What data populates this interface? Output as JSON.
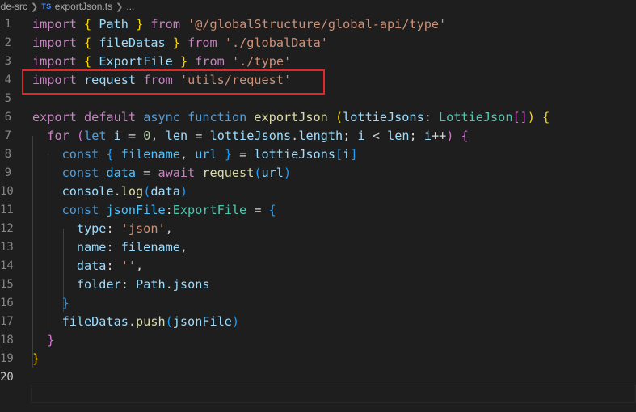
{
  "breadcrumb": {
    "folder": "ode-src",
    "file_icon": "TS",
    "file": "exportJson.ts",
    "trail": "..."
  },
  "editor": {
    "language": "typescript",
    "current_line": 20,
    "highlighted_line": 4,
    "highlight_color": "#e0282c",
    "lines": [
      {
        "num": "1",
        "tokens": [
          {
            "t": "import",
            "c": "keyword"
          },
          {
            "t": " ",
            "c": "punct"
          },
          {
            "t": "{",
            "c": "b1"
          },
          {
            "t": " ",
            "c": "punct"
          },
          {
            "t": "Path",
            "c": "var"
          },
          {
            "t": " ",
            "c": "punct"
          },
          {
            "t": "}",
            "c": "b1"
          },
          {
            "t": " ",
            "c": "punct"
          },
          {
            "t": "from",
            "c": "keyword"
          },
          {
            "t": " ",
            "c": "punct"
          },
          {
            "t": "'@/globalStructure/global-api/type'",
            "c": "string"
          }
        ]
      },
      {
        "num": "2",
        "tokens": [
          {
            "t": "import",
            "c": "keyword"
          },
          {
            "t": " ",
            "c": "punct"
          },
          {
            "t": "{",
            "c": "b1"
          },
          {
            "t": " ",
            "c": "punct"
          },
          {
            "t": "fileDatas",
            "c": "var"
          },
          {
            "t": " ",
            "c": "punct"
          },
          {
            "t": "}",
            "c": "b1"
          },
          {
            "t": " ",
            "c": "punct"
          },
          {
            "t": "from",
            "c": "keyword"
          },
          {
            "t": " ",
            "c": "punct"
          },
          {
            "t": "'./globalData'",
            "c": "string"
          }
        ]
      },
      {
        "num": "3",
        "tokens": [
          {
            "t": "import",
            "c": "keyword"
          },
          {
            "t": " ",
            "c": "punct"
          },
          {
            "t": "{",
            "c": "b1"
          },
          {
            "t": " ",
            "c": "punct"
          },
          {
            "t": "ExportFile",
            "c": "var"
          },
          {
            "t": " ",
            "c": "punct"
          },
          {
            "t": "}",
            "c": "b1"
          },
          {
            "t": " ",
            "c": "punct"
          },
          {
            "t": "from",
            "c": "keyword"
          },
          {
            "t": " ",
            "c": "punct"
          },
          {
            "t": "'./type'",
            "c": "string"
          }
        ]
      },
      {
        "num": "4",
        "tokens": [
          {
            "t": "import",
            "c": "keyword"
          },
          {
            "t": " ",
            "c": "punct"
          },
          {
            "t": "request",
            "c": "var"
          },
          {
            "t": " ",
            "c": "punct"
          },
          {
            "t": "from",
            "c": "keyword"
          },
          {
            "t": " ",
            "c": "punct"
          },
          {
            "t": "'utils/request'",
            "c": "string"
          }
        ]
      },
      {
        "num": "5",
        "tokens": []
      },
      {
        "num": "6",
        "tokens": [
          {
            "t": "export",
            "c": "keyword"
          },
          {
            "t": " ",
            "c": "punct"
          },
          {
            "t": "default",
            "c": "keyword"
          },
          {
            "t": " ",
            "c": "punct"
          },
          {
            "t": "async",
            "c": "storage"
          },
          {
            "t": " ",
            "c": "punct"
          },
          {
            "t": "function",
            "c": "storage"
          },
          {
            "t": " ",
            "c": "punct"
          },
          {
            "t": "exportJson",
            "c": "func"
          },
          {
            "t": " ",
            "c": "punct"
          },
          {
            "t": "(",
            "c": "b1"
          },
          {
            "t": "lottieJsons",
            "c": "var"
          },
          {
            "t": ": ",
            "c": "punct"
          },
          {
            "t": "LottieJson",
            "c": "type"
          },
          {
            "t": "[]",
            "c": "b2"
          },
          {
            "t": ")",
            "c": "b1"
          },
          {
            "t": " ",
            "c": "punct"
          },
          {
            "t": "{",
            "c": "b1"
          }
        ]
      },
      {
        "num": "7",
        "tokens": [
          {
            "t": "  ",
            "c": "punct"
          },
          {
            "t": "for",
            "c": "keyword"
          },
          {
            "t": " ",
            "c": "punct"
          },
          {
            "t": "(",
            "c": "b2"
          },
          {
            "t": "let",
            "c": "storage"
          },
          {
            "t": " ",
            "c": "punct"
          },
          {
            "t": "i",
            "c": "var"
          },
          {
            "t": " = ",
            "c": "punct"
          },
          {
            "t": "0",
            "c": "number"
          },
          {
            "t": ", ",
            "c": "punct"
          },
          {
            "t": "len",
            "c": "var"
          },
          {
            "t": " = ",
            "c": "punct"
          },
          {
            "t": "lottieJsons",
            "c": "var"
          },
          {
            "t": ".",
            "c": "punct"
          },
          {
            "t": "length",
            "c": "var"
          },
          {
            "t": "; ",
            "c": "punct"
          },
          {
            "t": "i",
            "c": "var"
          },
          {
            "t": " < ",
            "c": "punct"
          },
          {
            "t": "len",
            "c": "var"
          },
          {
            "t": "; ",
            "c": "punct"
          },
          {
            "t": "i",
            "c": "var"
          },
          {
            "t": "++",
            "c": "punct"
          },
          {
            "t": ")",
            "c": "b2"
          },
          {
            "t": " ",
            "c": "punct"
          },
          {
            "t": "{",
            "c": "b2"
          }
        ]
      },
      {
        "num": "8",
        "tokens": [
          {
            "t": "    ",
            "c": "punct"
          },
          {
            "t": "const",
            "c": "storage"
          },
          {
            "t": " ",
            "c": "punct"
          },
          {
            "t": "{",
            "c": "b3"
          },
          {
            "t": " ",
            "c": "punct"
          },
          {
            "t": "filename",
            "c": "const"
          },
          {
            "t": ", ",
            "c": "punct"
          },
          {
            "t": "url",
            "c": "const"
          },
          {
            "t": " ",
            "c": "punct"
          },
          {
            "t": "}",
            "c": "b3"
          },
          {
            "t": " = ",
            "c": "punct"
          },
          {
            "t": "lottieJsons",
            "c": "var"
          },
          {
            "t": "[",
            "c": "b3"
          },
          {
            "t": "i",
            "c": "var"
          },
          {
            "t": "]",
            "c": "b3"
          }
        ]
      },
      {
        "num": "9",
        "tokens": [
          {
            "t": "    ",
            "c": "punct"
          },
          {
            "t": "const",
            "c": "storage"
          },
          {
            "t": " ",
            "c": "punct"
          },
          {
            "t": "data",
            "c": "const"
          },
          {
            "t": " = ",
            "c": "punct"
          },
          {
            "t": "await",
            "c": "keyword"
          },
          {
            "t": " ",
            "c": "punct"
          },
          {
            "t": "request",
            "c": "func"
          },
          {
            "t": "(",
            "c": "b3"
          },
          {
            "t": "url",
            "c": "var"
          },
          {
            "t": ")",
            "c": "b3"
          }
        ]
      },
      {
        "num": "10",
        "tokens": [
          {
            "t": "    ",
            "c": "punct"
          },
          {
            "t": "console",
            "c": "var"
          },
          {
            "t": ".",
            "c": "punct"
          },
          {
            "t": "log",
            "c": "func"
          },
          {
            "t": "(",
            "c": "b3"
          },
          {
            "t": "data",
            "c": "var"
          },
          {
            "t": ")",
            "c": "b3"
          }
        ]
      },
      {
        "num": "11",
        "tokens": [
          {
            "t": "    ",
            "c": "punct"
          },
          {
            "t": "const",
            "c": "storage"
          },
          {
            "t": " ",
            "c": "punct"
          },
          {
            "t": "jsonFile",
            "c": "const"
          },
          {
            "t": ":",
            "c": "punct"
          },
          {
            "t": "ExportFile",
            "c": "type"
          },
          {
            "t": " = ",
            "c": "punct"
          },
          {
            "t": "{",
            "c": "b3"
          }
        ]
      },
      {
        "num": "12",
        "tokens": [
          {
            "t": "      ",
            "c": "punct"
          },
          {
            "t": "type",
            "c": "var"
          },
          {
            "t": ": ",
            "c": "punct"
          },
          {
            "t": "'json'",
            "c": "string"
          },
          {
            "t": ",",
            "c": "punct"
          }
        ]
      },
      {
        "num": "13",
        "tokens": [
          {
            "t": "      ",
            "c": "punct"
          },
          {
            "t": "name",
            "c": "var"
          },
          {
            "t": ": ",
            "c": "punct"
          },
          {
            "t": "filename",
            "c": "var"
          },
          {
            "t": ",",
            "c": "punct"
          }
        ]
      },
      {
        "num": "14",
        "tokens": [
          {
            "t": "      ",
            "c": "punct"
          },
          {
            "t": "data",
            "c": "var"
          },
          {
            "t": ": ",
            "c": "punct"
          },
          {
            "t": "''",
            "c": "string"
          },
          {
            "t": ",",
            "c": "punct"
          }
        ]
      },
      {
        "num": "15",
        "tokens": [
          {
            "t": "      ",
            "c": "punct"
          },
          {
            "t": "folder",
            "c": "var"
          },
          {
            "t": ": ",
            "c": "punct"
          },
          {
            "t": "Path",
            "c": "var"
          },
          {
            "t": ".",
            "c": "punct"
          },
          {
            "t": "jsons",
            "c": "var"
          }
        ]
      },
      {
        "num": "16",
        "tokens": [
          {
            "t": "    ",
            "c": "punct"
          },
          {
            "t": "}",
            "c": "b3"
          }
        ]
      },
      {
        "num": "17",
        "tokens": [
          {
            "t": "    ",
            "c": "punct"
          },
          {
            "t": "fileDatas",
            "c": "var"
          },
          {
            "t": ".",
            "c": "punct"
          },
          {
            "t": "push",
            "c": "func"
          },
          {
            "t": "(",
            "c": "b3"
          },
          {
            "t": "jsonFile",
            "c": "var"
          },
          {
            "t": ")",
            "c": "b3"
          }
        ]
      },
      {
        "num": "18",
        "tokens": [
          {
            "t": "  ",
            "c": "punct"
          },
          {
            "t": "}",
            "c": "b2"
          }
        ]
      },
      {
        "num": "19",
        "tokens": [
          {
            "t": "}",
            "c": "b1"
          }
        ]
      },
      {
        "num": "20",
        "tokens": []
      }
    ]
  }
}
